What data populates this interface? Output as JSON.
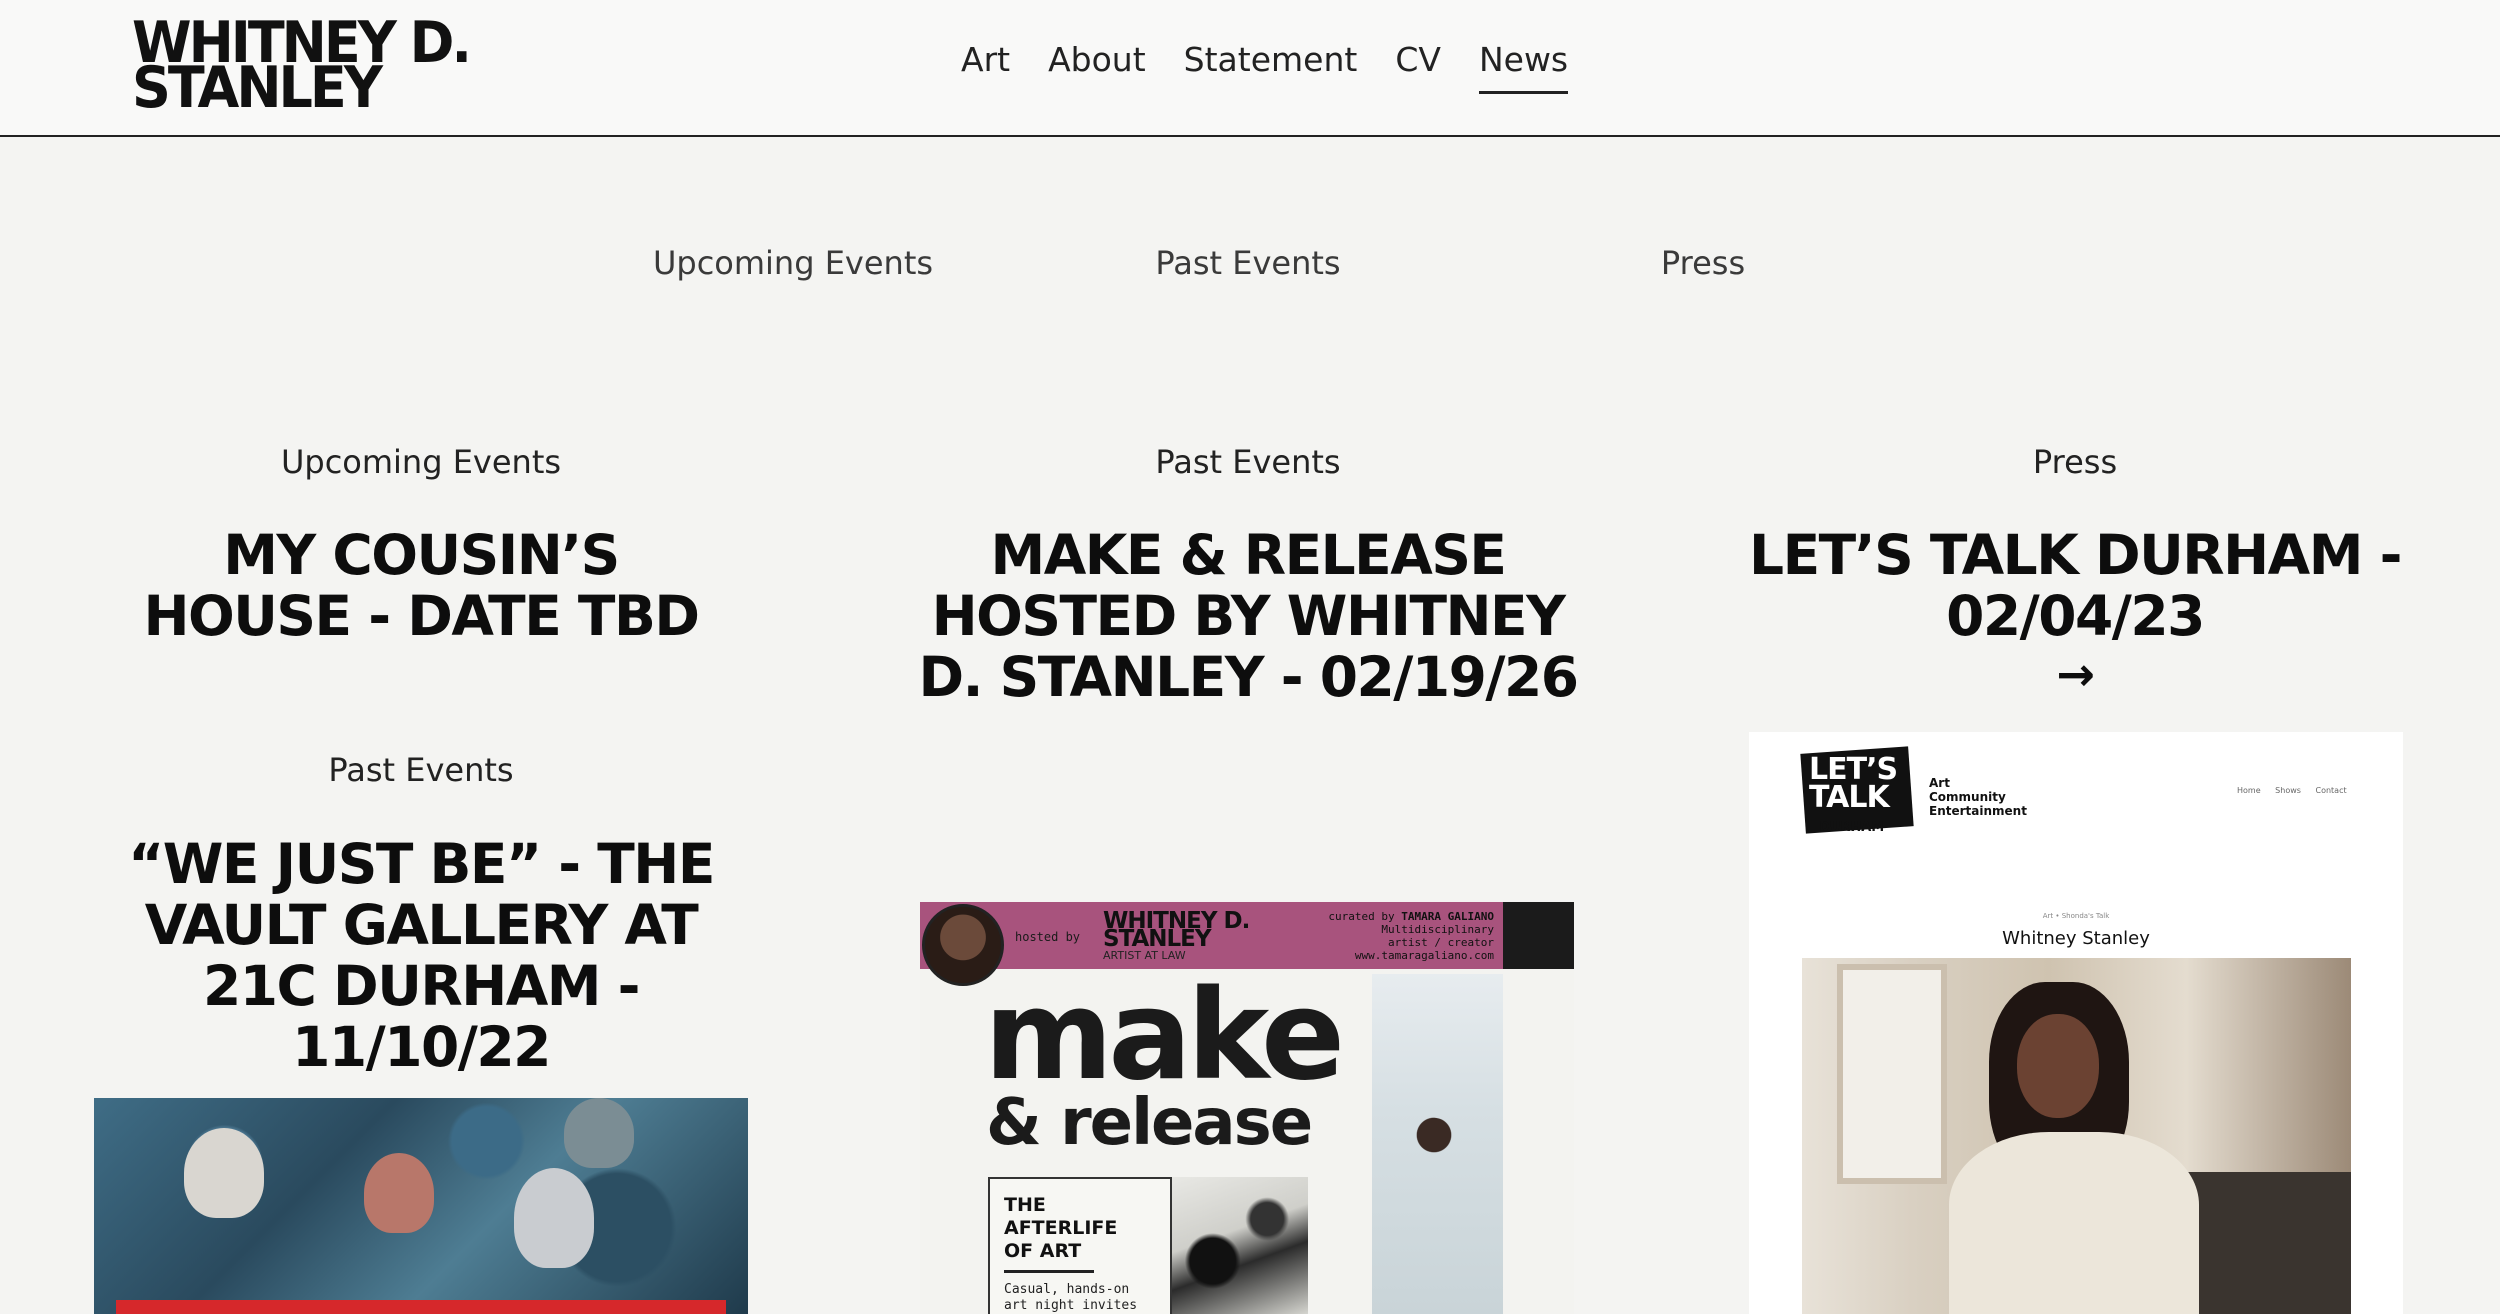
{
  "header": {
    "logo_line1": "WHITNEY D.",
    "logo_line2": "STANLEY",
    "nav": [
      "Art",
      "About",
      "Statement",
      "CV",
      "News"
    ],
    "active_nav": "News"
  },
  "subnav": [
    "Upcoming Events",
    "Past Events",
    "Press"
  ],
  "columns": [
    {
      "label": "Upcoming Events",
      "title": "MY COUSIN’S HOUSE - DATE TBD"
    },
    {
      "label": "Past Events",
      "title": "MAKE & RELEASE HOSTED BY WHITNEY D. STANLEY - 02/19/26"
    },
    {
      "label": "Press",
      "title": "LET’S TALK DURHAM - 02/04/23",
      "arrow": "→"
    }
  ],
  "second_block": {
    "label": "Past Events",
    "title": "“WE JUST BE” - THE VAULT GALLERY AT 21C DURHAM - 11/10/22"
  },
  "poster": {
    "hosted_by": "hosted by",
    "name_line1": "WHITNEY D.",
    "name_line2": "STANLEY",
    "tagline": "ARTIST AT LAW",
    "curated_by": "curated by",
    "curator": "TAMARA GALIANO",
    "curator_role_1": "Multidisciplinary",
    "curator_role_2": "artist / creator",
    "curator_site": "www.tamaragaliano.com",
    "make": "make",
    "release": "& release",
    "afterlife_1": "THE",
    "afterlife_2": "AFTERLIFE",
    "afterlife_3": "OF ART",
    "casual_1": "Casual, hands-on",
    "casual_2": "art night invites"
  },
  "ltd": {
    "badge_1": "LET’S",
    "badge_2": "TALK",
    "badge_3": "DURHAM",
    "acet_1": "Art",
    "acet_2": "Community",
    "acet_3": "Entertainment",
    "mininav": [
      "Home",
      "Shows",
      "Contact"
    ],
    "crumb": "Art • Shonda's Talk",
    "name": "Whitney Stanley"
  }
}
